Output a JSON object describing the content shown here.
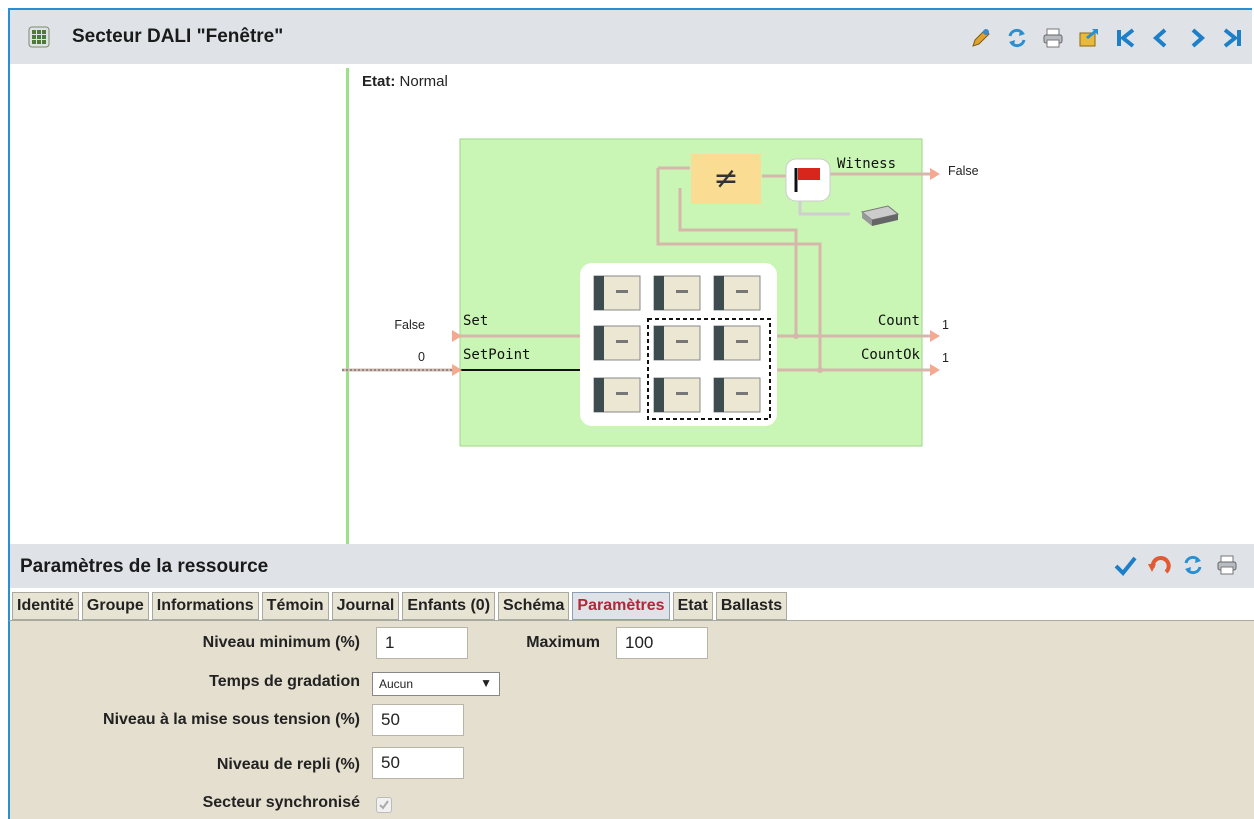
{
  "header": {
    "title": "Secteur DALI \"Fenêtre\""
  },
  "toolbar": {
    "icons": [
      "edit-icon",
      "refresh-icon",
      "print-icon",
      "export-icon",
      "first-icon",
      "prev-icon",
      "next-icon",
      "last-icon"
    ]
  },
  "state": {
    "label": "Etat:",
    "value": "Normal"
  },
  "diagram": {
    "inputs": [
      {
        "name": "Set",
        "value": "False"
      },
      {
        "name": "SetPoint",
        "value": "0"
      }
    ],
    "outputs": [
      {
        "name": "Count",
        "value": "1"
      },
      {
        "name": "CountOk",
        "value": "1"
      }
    ],
    "witness": {
      "name": "Witness",
      "value": "False"
    },
    "operator": "≠"
  },
  "params": {
    "title": "Paramètres de la ressource",
    "tabs": [
      "Identité",
      "Groupe",
      "Informations",
      "Témoin",
      "Journal",
      "Enfants (0)",
      "Schéma",
      "Paramètres",
      "Etat",
      "Ballasts"
    ],
    "active_tab": "Paramètres",
    "fields": {
      "min_label": "Niveau minimum (%)",
      "min_value": "1",
      "max_label": "Maximum",
      "max_value": "100",
      "fade_label": "Temps de gradation",
      "fade_value": "Aucun",
      "power_label": "Niveau à la mise sous tension (%)",
      "power_value": "50",
      "fallback_label": "Niveau de repli (%)",
      "fallback_value": "50",
      "sync_label": "Secteur synchronisé"
    }
  },
  "colors": {
    "accent": "#2a8fcf",
    "active_tab": "#b1283a",
    "block_fill": "#c9f6b4"
  }
}
